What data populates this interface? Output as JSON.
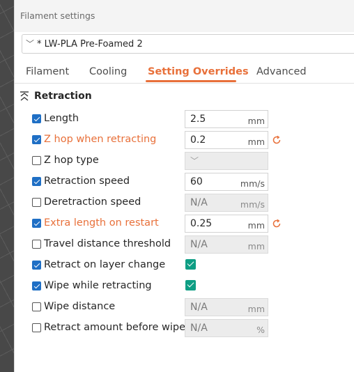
{
  "window": {
    "title": "Filament settings"
  },
  "preset": {
    "name": "* LW-PLA Pre-Foamed 2"
  },
  "tabs": [
    {
      "label": "Filament",
      "active": false
    },
    {
      "label": "Cooling",
      "active": false
    },
    {
      "label": "Setting Overrides",
      "active": true
    },
    {
      "label": "Advanced",
      "active": false
    }
  ],
  "colors": {
    "accent": "#e8703a",
    "checkbox": "#1f6fc5",
    "toggle": "#0e9e84"
  },
  "section": {
    "title": "Retraction",
    "icon": "collapse-arrows-icon"
  },
  "rows": [
    {
      "label": "Length",
      "checked": true,
      "modified": false,
      "control": "input",
      "value": "2.5",
      "unit": "mm"
    },
    {
      "label": "Z hop when retracting",
      "checked": true,
      "modified": true,
      "control": "input",
      "value": "0.2",
      "unit": "mm"
    },
    {
      "label": "Z hop type",
      "checked": false,
      "modified": false,
      "control": "combo"
    },
    {
      "label": "Retraction speed",
      "checked": true,
      "modified": false,
      "control": "input",
      "value": "60",
      "unit": "mm/s"
    },
    {
      "label": "Deretraction speed",
      "checked": false,
      "modified": false,
      "control": "input",
      "value": "N/A",
      "unit": "mm/s"
    },
    {
      "label": "Extra length on restart",
      "checked": true,
      "modified": true,
      "control": "input",
      "value": "0.25",
      "unit": "mm"
    },
    {
      "label": "Travel distance threshold",
      "checked": false,
      "modified": false,
      "control": "input",
      "value": "N/A",
      "unit": "mm"
    },
    {
      "label": "Retract on layer change",
      "checked": true,
      "modified": false,
      "control": "toggle",
      "on": true
    },
    {
      "label": "Wipe while retracting",
      "checked": true,
      "modified": false,
      "control": "toggle",
      "on": true
    },
    {
      "label": "Wipe distance",
      "checked": false,
      "modified": false,
      "control": "input",
      "value": "N/A",
      "unit": "mm"
    },
    {
      "label": "Retract amount before wipe",
      "checked": false,
      "modified": false,
      "control": "input",
      "value": "N/A",
      "unit": "%"
    }
  ]
}
